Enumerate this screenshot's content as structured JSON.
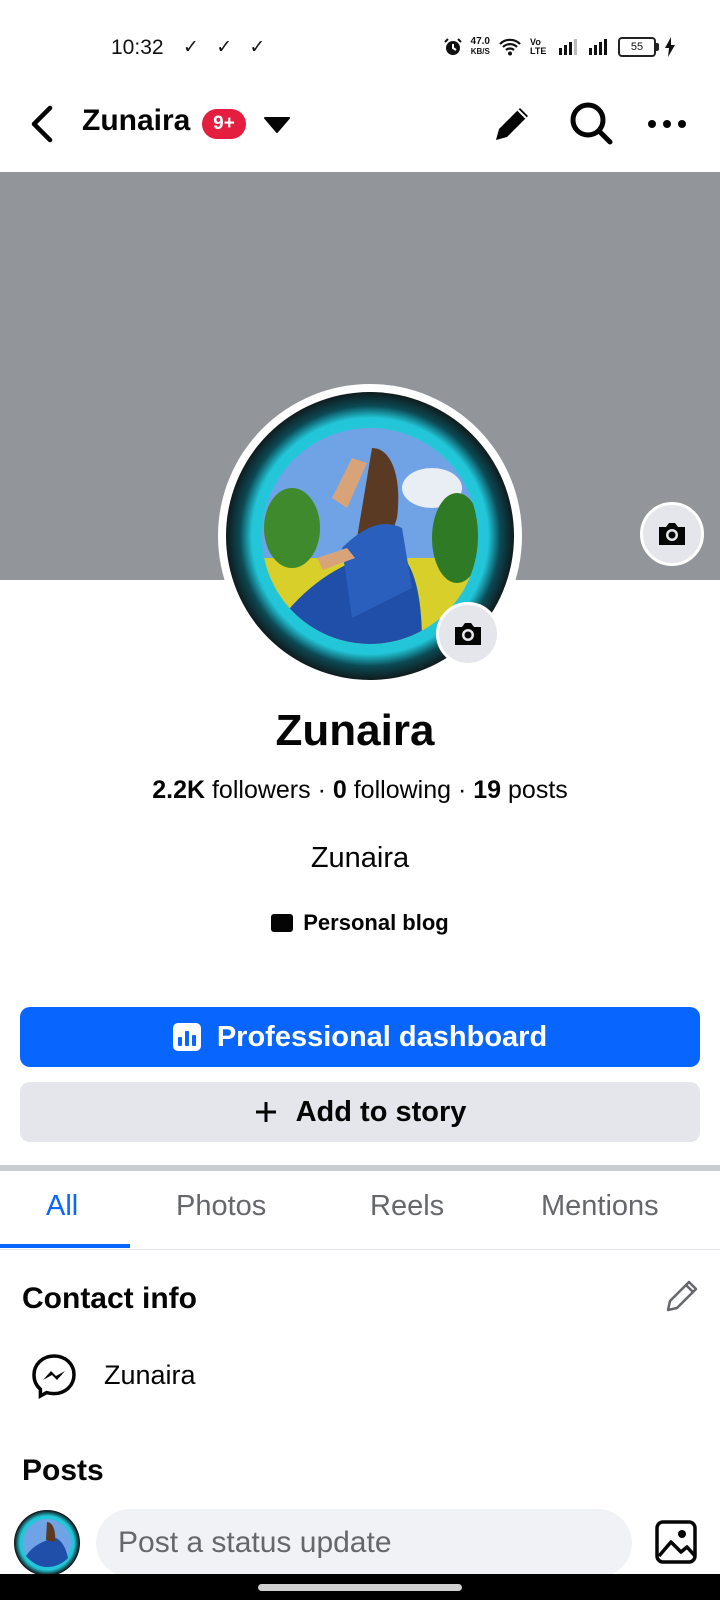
{
  "status_bar": {
    "time": "10:32",
    "checks": "✓ ✓ ✓",
    "net_speed_value": "47.0",
    "net_speed_unit": "KB/S",
    "volte": "Vo LTE",
    "battery": "55"
  },
  "header": {
    "name": "Zunaira",
    "badge": "9+"
  },
  "profile": {
    "name": "Zunaira",
    "followers_count": "2.2K",
    "followers_label": "followers",
    "following_count": "0",
    "following_label": "following",
    "posts_count": "19",
    "posts_label": "posts",
    "separator": "·",
    "bio": "Zunaira",
    "category": "Personal blog"
  },
  "actions": {
    "dashboard_label": "Professional dashboard",
    "story_label": "Add to story"
  },
  "tabs": [
    {
      "label": "All"
    },
    {
      "label": "Photos"
    },
    {
      "label": "Reels"
    },
    {
      "label": "Mentions"
    }
  ],
  "contact": {
    "title": "Contact info",
    "messenger_name": "Zunaira"
  },
  "posts": {
    "title": "Posts",
    "composer_placeholder": "Post a status update"
  },
  "colors": {
    "accent": "#0866ff",
    "badge": "#e41e3f",
    "cover": "#929599",
    "secondary_button": "#e4e6eb"
  }
}
